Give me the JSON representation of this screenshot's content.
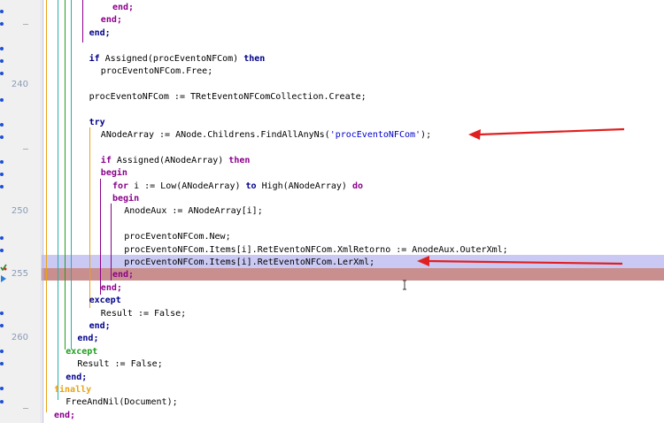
{
  "gutter": {
    "line_numbers": [
      "240",
      "250",
      "255",
      "260"
    ]
  },
  "code_lines": [
    {
      "indent": 10,
      "segments": [
        {
          "t": "end;",
          "c": "kw-end"
        }
      ]
    },
    {
      "indent": 8,
      "segments": [
        {
          "t": "end;",
          "c": "kw-end"
        }
      ]
    },
    {
      "indent": 6,
      "segments": [
        {
          "t": "end;",
          "c": "kw"
        }
      ]
    },
    {
      "indent": 0,
      "segments": []
    },
    {
      "indent": 6,
      "segments": [
        {
          "t": "if",
          "c": "kw"
        },
        {
          "t": " Assigned(procEventoNFCom) ",
          "c": ""
        },
        {
          "t": "then",
          "c": "kw"
        }
      ]
    },
    {
      "indent": 8,
      "segments": [
        {
          "t": "procEventoNFCom.Free;",
          "c": ""
        }
      ]
    },
    {
      "indent": 0,
      "segments": []
    },
    {
      "indent": 6,
      "segments": [
        {
          "t": "procEventoNFCom := TRetEventoNFComCollection.Create;",
          "c": ""
        }
      ]
    },
    {
      "indent": 0,
      "segments": []
    },
    {
      "indent": 6,
      "segments": [
        {
          "t": "try",
          "c": "kw"
        }
      ]
    },
    {
      "indent": 8,
      "segments": [
        {
          "t": "ANodeArray := ANode.Childrens.FindAllAnyNs(",
          "c": ""
        },
        {
          "t": "'procEventoNFCom'",
          "c": "str"
        },
        {
          "t": ");",
          "c": ""
        }
      ]
    },
    {
      "indent": 0,
      "segments": []
    },
    {
      "indent": 8,
      "segments": [
        {
          "t": "if",
          "c": "kw-end"
        },
        {
          "t": " Assigned(ANodeArray) ",
          "c": ""
        },
        {
          "t": "then",
          "c": "kw-end"
        }
      ]
    },
    {
      "indent": 8,
      "segments": [
        {
          "t": "begin",
          "c": "kw-end"
        }
      ]
    },
    {
      "indent": 10,
      "segments": [
        {
          "t": "for",
          "c": "kw-end"
        },
        {
          "t": " i := Low(ANodeArray) ",
          "c": ""
        },
        {
          "t": "to",
          "c": "kw"
        },
        {
          "t": " High(ANodeArray) ",
          "c": ""
        },
        {
          "t": "do",
          "c": "kw-end"
        }
      ]
    },
    {
      "indent": 10,
      "segments": [
        {
          "t": "begin",
          "c": "kw-end"
        }
      ]
    },
    {
      "indent": 12,
      "segments": [
        {
          "t": "AnodeAux := ANodeArray[i];",
          "c": ""
        }
      ]
    },
    {
      "indent": 0,
      "segments": []
    },
    {
      "indent": 12,
      "segments": [
        {
          "t": "procEventoNFCom.New;",
          "c": ""
        }
      ]
    },
    {
      "indent": 12,
      "segments": [
        {
          "t": "procEventoNFCom.Items[i].RetEventoNFCom.XmlRetorno := AnodeAux.OuterXml;",
          "c": ""
        }
      ]
    },
    {
      "indent": 12,
      "segments": [
        {
          "t": "procEventoNFCom.Items[i].RetEventoNFCom.LerXml;",
          "c": ""
        }
      ]
    },
    {
      "indent": 10,
      "segments": [
        {
          "t": "end;",
          "c": "kw-end"
        }
      ]
    },
    {
      "indent": 8,
      "segments": [
        {
          "t": "end;",
          "c": "kw-end"
        }
      ]
    },
    {
      "indent": 6,
      "segments": [
        {
          "t": "except",
          "c": "kw"
        }
      ]
    },
    {
      "indent": 8,
      "segments": [
        {
          "t": "Result := False;",
          "c": ""
        }
      ]
    },
    {
      "indent": 6,
      "segments": [
        {
          "t": "end;",
          "c": "kw"
        }
      ]
    },
    {
      "indent": 4,
      "segments": [
        {
          "t": "end;",
          "c": "kw"
        }
      ]
    },
    {
      "indent": 2,
      "segments": [
        {
          "t": "except",
          "c": "kw-green"
        }
      ]
    },
    {
      "indent": 4,
      "segments": [
        {
          "t": "Result := False;",
          "c": ""
        }
      ]
    },
    {
      "indent": 2,
      "segments": [
        {
          "t": "end;",
          "c": "kw"
        }
      ]
    },
    {
      "indent": 0,
      "segments": [
        {
          "t": "finally",
          "c": "kw-orange"
        }
      ]
    },
    {
      "indent": 2,
      "segments": [
        {
          "t": "FreeAndNil(Document);",
          "c": ""
        }
      ]
    },
    {
      "indent": 0,
      "segments": [
        {
          "t": "end;",
          "c": "kw-end"
        }
      ]
    }
  ],
  "colors": {
    "orange": "#e8a317",
    "green": "#1f9d1f",
    "teal": "#20b2aa",
    "purple": "#8b008b",
    "arrow_red": "#e02020"
  }
}
